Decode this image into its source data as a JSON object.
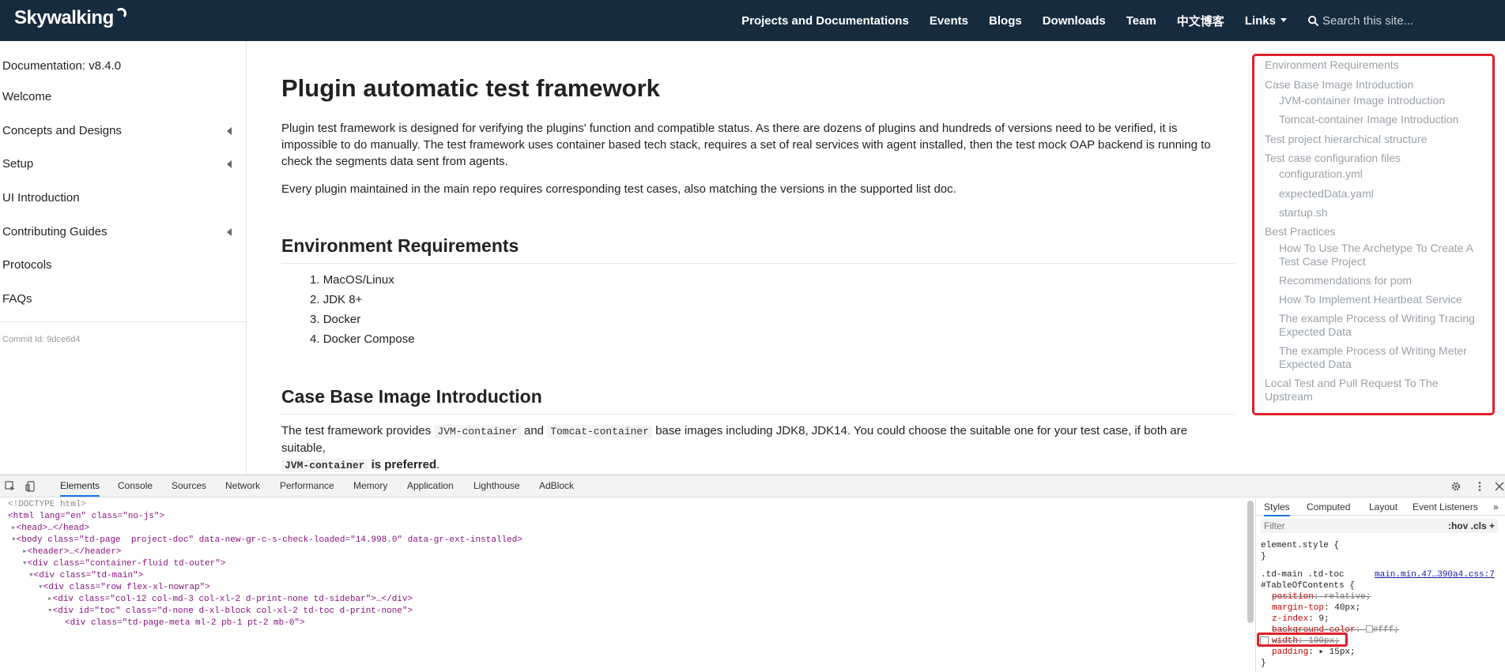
{
  "nav": {
    "brand": "Skywalking",
    "links": [
      "Projects and Documentations",
      "Events",
      "Blogs",
      "Downloads",
      "Team",
      "中文博客",
      "Links"
    ],
    "search_placeholder": "Search this site..."
  },
  "sidebar": {
    "title": "Documentation: v8.4.0",
    "items": [
      {
        "label": "Welcome",
        "expandable": false
      },
      {
        "label": "Concepts and Designs",
        "expandable": true
      },
      {
        "label": "Setup",
        "expandable": true
      },
      {
        "label": "UI Introduction",
        "expandable": false
      },
      {
        "label": "Contributing Guides",
        "expandable": true
      },
      {
        "label": "Protocols",
        "expandable": false
      },
      {
        "label": "FAQs",
        "expandable": false
      }
    ],
    "commit": "Commit Id: 9dce6d4"
  },
  "main": {
    "title": "Plugin automatic test framework",
    "intro_1": "Plugin test framework is designed for verifying the plugins' function and compatible status. As there are dozens of plugins and hundreds of versions need to be verified, it is impossible to do manually. The test framework uses container based tech stack, requires a set of real services with agent installed, then the test mock OAP backend is running to check the segments data sent from agents.",
    "intro_2": "Every plugin maintained in the main repo requires corresponding test cases, also matching the versions in the supported list doc.",
    "env_heading": "Environment Requirements",
    "env_list": [
      "MacOS/Linux",
      "JDK 8+",
      "Docker",
      "Docker Compose"
    ],
    "case_heading": "Case Base Image Introduction",
    "case_text_1": "The test framework provides ",
    "case_code_1": "JVM-container",
    "case_text_2": " and ",
    "case_code_2": "Tomcat-container",
    "case_text_3": " base images including JDK8, JDK14. You could choose the suitable one for your test case, if both are suitable,",
    "case_code_3": "JVM-container",
    "case_text_4": " is preferred",
    "case_text_5": "."
  },
  "toc": {
    "items": [
      {
        "label": "Environment Requirements",
        "level": 1
      },
      {
        "label": "Case Base Image Introduction",
        "level": 1
      },
      {
        "label": "JVM-container Image Introduction",
        "level": 2
      },
      {
        "label": "Tomcat-container Image Introduction",
        "level": 2
      },
      {
        "label": "Test project hierarchical structure",
        "level": 1
      },
      {
        "label": "Test case configuration files",
        "level": 1
      },
      {
        "label": "configuration.yml",
        "level": 2
      },
      {
        "label": "expectedData.yaml",
        "level": 2
      },
      {
        "label": "startup.sh",
        "level": 2
      },
      {
        "label": "Best Practices",
        "level": 1
      },
      {
        "label": "How To Use The Archetype To Create A Test Case Project",
        "level": 2
      },
      {
        "label": "Recommendations for pom",
        "level": 2
      },
      {
        "label": "How To Implement Heartbeat Service",
        "level": 2
      },
      {
        "label": "The example Process of Writing Tracing Expected Data",
        "level": 2
      },
      {
        "label": "The example Process of Writing Meter Expected Data",
        "level": 2
      },
      {
        "label": "Local Test and Pull Request To The Upstream",
        "level": 1
      }
    ]
  },
  "devtools": {
    "tabs": [
      "Elements",
      "Console",
      "Sources",
      "Network",
      "Performance",
      "Memory",
      "Application",
      "Lighthouse",
      "AdBlock"
    ],
    "active_tab": "Elements",
    "styles_tabs": [
      "Styles",
      "Computed",
      "Layout",
      "Event Listeners"
    ],
    "filter_placeholder": "Filter",
    "filter_opts": ":hov  .cls  +",
    "dom": {
      "doctype": "<!DOCTYPE html>",
      "html_open": "<html lang=\"en\" class=\"no-js\">",
      "head": "<head>…</head>",
      "body": "<body class=\"td-page  project-doc\" data-new-gr-c-s-check-loaded=\"14.998.0\" data-gr-ext-installed>",
      "header": "<header>…</header>",
      "container": "<div class=\"container-fluid td-outer\">",
      "td_main": "<div class=\"td-main\">",
      "row": "<div class=\"row flex-xl-nowrap\">",
      "col_sidebar": "<div class=\"col-12 col-md-3 col-xl-2 d-print-none td-sidebar\">…</div>",
      "toc": "<div id=\"toc\" class=\"d-none d-xl-block col-xl-2 td-toc d-print-none\">",
      "page_meta": "<div class=\"td-page-meta ml-2 pb-1 pt-2 mb-0\">"
    },
    "styles": {
      "element_style": "element.style {",
      "close": "}",
      "selector_1": ".td-main .td-toc",
      "selector_2": "#TableOfContents {",
      "source": "main.min.47…390a4.css:7",
      "props": [
        {
          "name": "position",
          "value": "relative;",
          "struck": true
        },
        {
          "name": "margin-top",
          "value": "40px;",
          "struck": false
        },
        {
          "name": "z-index",
          "value": "9;",
          "struck": false
        },
        {
          "name": "background-color",
          "value": "#fff;",
          "struck": true
        },
        {
          "name": "width",
          "value": "190px;",
          "struck": true
        },
        {
          "name": "padding",
          "value": "15px;",
          "struck": false
        }
      ]
    }
  }
}
